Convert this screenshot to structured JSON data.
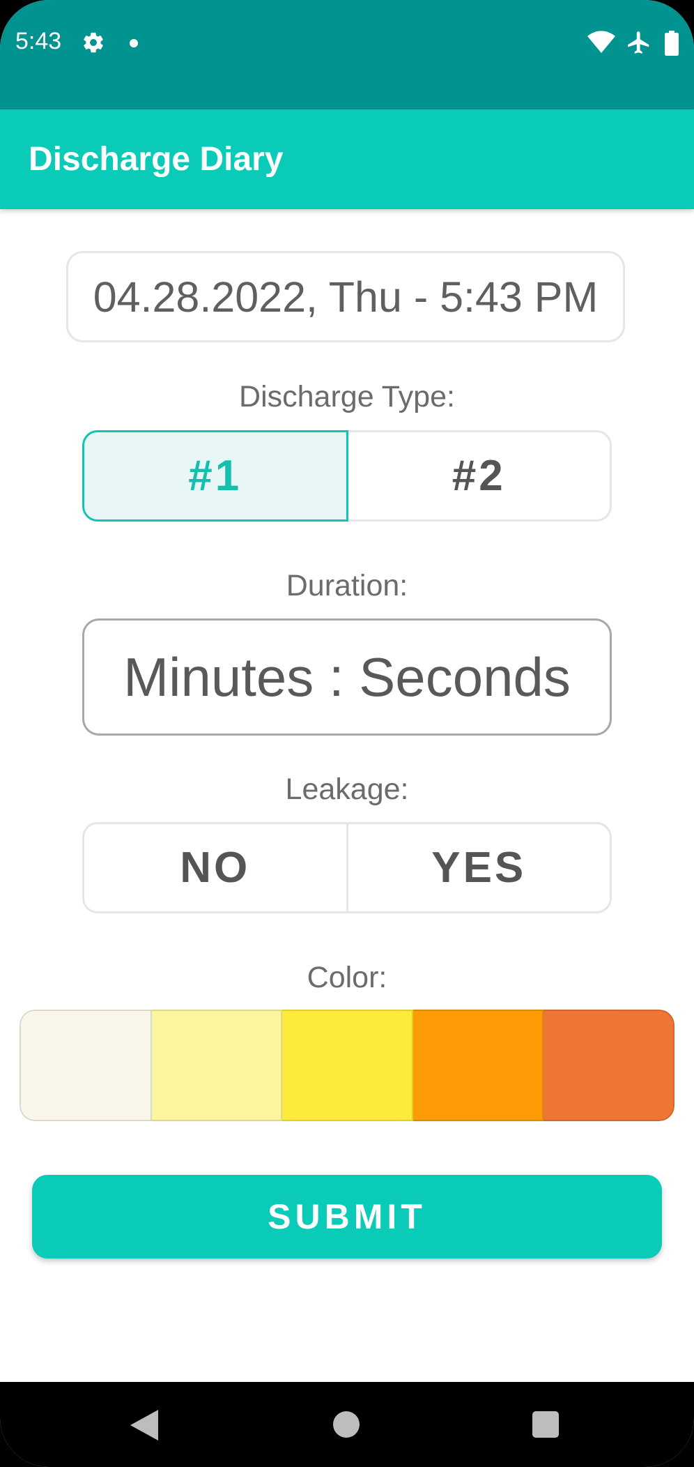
{
  "status_bar": {
    "time": "5:43",
    "icons": [
      "gear-icon",
      "dot-icon",
      "wifi-icon",
      "airplane-icon",
      "battery-icon"
    ],
    "background": "#009390"
  },
  "app_bar": {
    "title": "Discharge Diary",
    "background": "#09cbb8"
  },
  "form": {
    "datetime": "04.28.2022, Thu - 5:43 PM",
    "discharge_type": {
      "label": "Discharge Type:",
      "options": [
        "#1",
        "#2"
      ],
      "selected": "#1"
    },
    "duration": {
      "label": "Duration:",
      "placeholder": "Minutes : Seconds"
    },
    "leakage": {
      "label": "Leakage:",
      "options": [
        "NO",
        "YES"
      ]
    },
    "color": {
      "label": "Color:",
      "swatches": [
        "#faf7ea",
        "#fef59f",
        "#feea3a",
        "#fd9c04",
        "#ef7534"
      ]
    },
    "submit_label": "SUBMIT"
  },
  "nav_bar": {
    "icons": [
      "back-icon",
      "home-icon",
      "recents-icon"
    ]
  }
}
